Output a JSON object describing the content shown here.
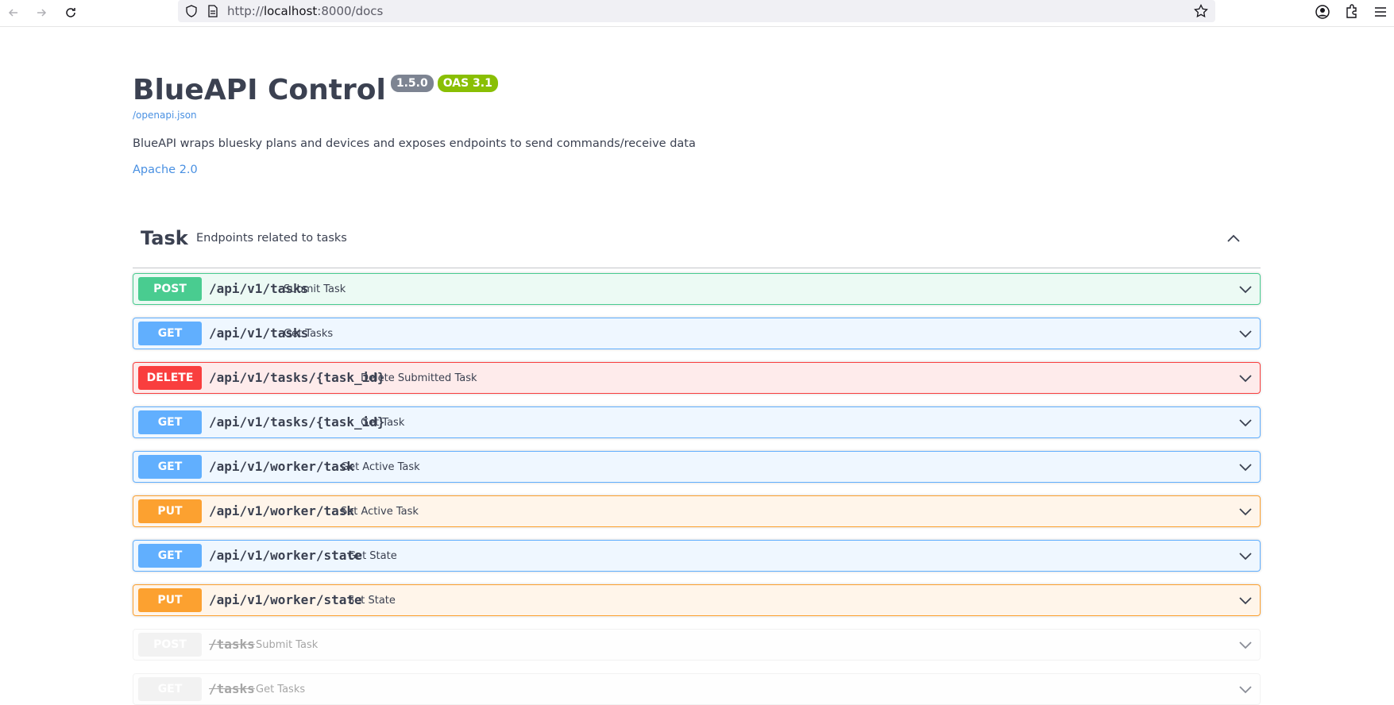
{
  "browser": {
    "url_prefix": "http://",
    "url_host": "localhost",
    "url_rest": ":8000/docs"
  },
  "info": {
    "title": "BlueAPI Control",
    "version": "1.5.0",
    "oas": "OAS 3.1",
    "spec_link": "/openapi.json",
    "description": "BlueAPI wraps bluesky plans and devices and exposes endpoints to send commands/receive data",
    "license": "Apache 2.0"
  },
  "tag": {
    "name": "Task",
    "description": "Endpoints related to tasks"
  },
  "operations": [
    {
      "method": "POST",
      "path": "/api/v1/tasks",
      "summary": "Submit Task"
    },
    {
      "method": "GET",
      "path": "/api/v1/tasks",
      "summary": "Get Tasks"
    },
    {
      "method": "DELETE",
      "path": "/api/v1/tasks/{task_id}",
      "summary": "Delete Submitted Task"
    },
    {
      "method": "GET",
      "path": "/api/v1/tasks/{task_id}",
      "summary": "Get Task"
    },
    {
      "method": "GET",
      "path": "/api/v1/worker/task",
      "summary": "Get Active Task"
    },
    {
      "method": "PUT",
      "path": "/api/v1/worker/task",
      "summary": "Set Active Task"
    },
    {
      "method": "GET",
      "path": "/api/v1/worker/state",
      "summary": "Get State"
    },
    {
      "method": "PUT",
      "path": "/api/v1/worker/state",
      "summary": "Set State"
    },
    {
      "method": "POST",
      "path": "/tasks",
      "summary": "Submit Task"
    },
    {
      "method": "GET",
      "path": "/tasks",
      "summary": "Get Tasks"
    }
  ],
  "colors": {
    "post": "#49cc90",
    "get": "#61affe",
    "delete": "#f93e3e",
    "put": "#fca130",
    "deprecated": "#ebebeb",
    "link": "#4990e2"
  }
}
